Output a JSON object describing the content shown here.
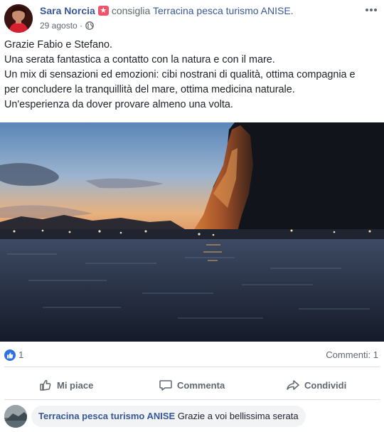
{
  "post": {
    "author": "Sara Norcia",
    "recommends": "consiglia",
    "page_name": "Terracina pesca turismo ANISE.",
    "date": "29 agosto",
    "dot": "·",
    "text_lines": [
      "Grazie Fabio e Stefano.",
      "Una serata fantastica a contatto con la natura e con il mare.",
      "Un mix di sensazioni ed emozioni: cibi nostrani di qualità, ottima compagnia e",
      "per concludere la tranquillità del mare, ottima medicina naturale.",
      "Un'esperienza da dover provare almeno una volta."
    ]
  },
  "stats": {
    "likes": "1",
    "comments": "Commenti: 1"
  },
  "actions": {
    "like": "Mi piace",
    "comment": "Commenta",
    "share": "Condividi"
  },
  "comment": {
    "author": "Terracina pesca turismo ANISE",
    "text": "Grazie a voi bellissima serata"
  },
  "colors": {
    "link": "#385898",
    "like_blue": "#2e6fe6",
    "badge_pink": "#f35369",
    "secondary_text": "#606770"
  },
  "icons": {
    "recommend_badge": "star-badge-icon",
    "privacy": "globe-icon",
    "more": "more-options-icon",
    "like": "thumbs-up-icon",
    "comment": "comment-bubble-icon",
    "share": "share-arrow-icon"
  }
}
